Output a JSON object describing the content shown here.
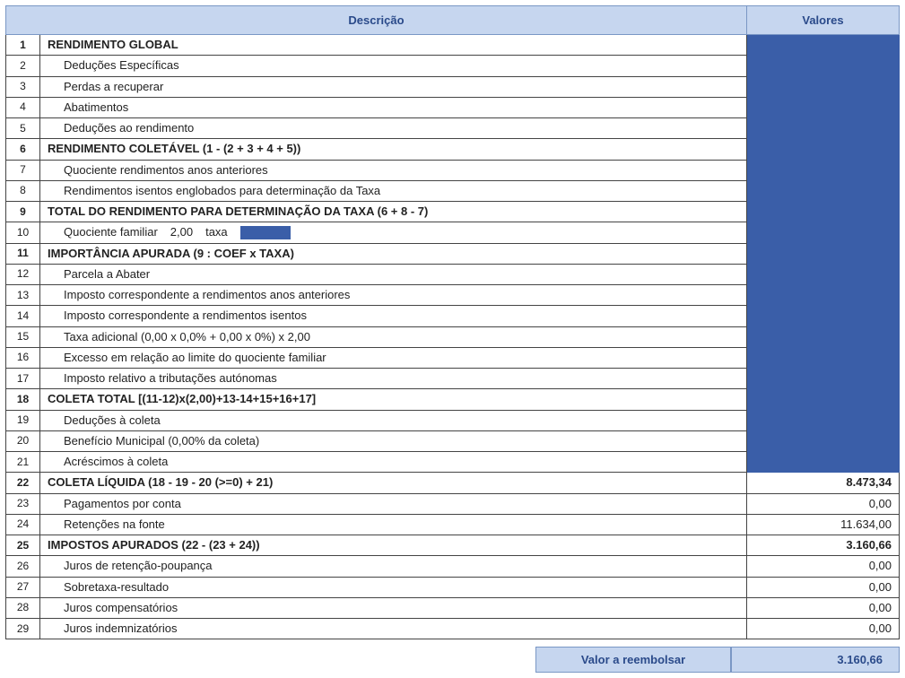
{
  "headers": {
    "descricao": "Descrição",
    "valores": "Valores"
  },
  "rows": [
    {
      "n": "1",
      "label": "RENDIMENTO GLOBAL",
      "bold": true,
      "indent": false,
      "value": "",
      "masked": true
    },
    {
      "n": "2",
      "label": "Deduções Específicas",
      "bold": false,
      "indent": true,
      "value": "",
      "masked": true
    },
    {
      "n": "3",
      "label": "Perdas a recuperar",
      "bold": false,
      "indent": true,
      "value": "",
      "masked": true
    },
    {
      "n": "4",
      "label": "Abatimentos",
      "bold": false,
      "indent": true,
      "value": "",
      "masked": true
    },
    {
      "n": "5",
      "label": "Deduções ao rendimento",
      "bold": false,
      "indent": true,
      "value": "",
      "masked": true
    },
    {
      "n": "6",
      "label": "RENDIMENTO COLETÁVEL (1 - (2 + 3 + 4 + 5))",
      "bold": true,
      "indent": false,
      "value": "",
      "masked": true
    },
    {
      "n": "7",
      "label": "Quociente rendimentos anos anteriores",
      "bold": false,
      "indent": true,
      "value": "",
      "masked": true
    },
    {
      "n": "8",
      "label": "Rendimentos isentos englobados para determinação da Taxa",
      "bold": false,
      "indent": true,
      "value": "",
      "masked": true
    },
    {
      "n": "9",
      "label": "TOTAL DO RENDIMENTO PARA DETERMINAÇÃO DA TAXA (6 + 8 - 7)",
      "bold": true,
      "indent": false,
      "value": "",
      "masked": true
    },
    {
      "n": "10",
      "label": "",
      "bold": false,
      "indent": true,
      "value": "",
      "masked": true,
      "special": "quociente"
    },
    {
      "n": "11",
      "label": "IMPORTÂNCIA APURADA (9 : COEF x TAXA)",
      "bold": true,
      "indent": false,
      "value": "",
      "masked": true
    },
    {
      "n": "12",
      "label": "Parcela a Abater",
      "bold": false,
      "indent": true,
      "value": "",
      "masked": true
    },
    {
      "n": "13",
      "label": "Imposto correspondente a rendimentos anos anteriores",
      "bold": false,
      "indent": true,
      "value": "",
      "masked": true
    },
    {
      "n": "14",
      "label": "Imposto correspondente a rendimentos isentos",
      "bold": false,
      "indent": true,
      "value": "",
      "masked": true
    },
    {
      "n": "15",
      "label": "Taxa adicional (0,00 x 0,0% + 0,00 x 0%) x 2,00",
      "bold": false,
      "indent": true,
      "value": "",
      "masked": true
    },
    {
      "n": "16",
      "label": "Excesso em relação ao limite do quociente familiar",
      "bold": false,
      "indent": true,
      "value": "",
      "masked": true
    },
    {
      "n": "17",
      "label": "Imposto relativo a tributações autónomas",
      "bold": false,
      "indent": true,
      "value": "",
      "masked": true
    },
    {
      "n": "18",
      "label": "COLETA TOTAL   [(11-12)x(2,00)+13-14+15+16+17]",
      "bold": true,
      "indent": false,
      "value": "",
      "masked": true
    },
    {
      "n": "19",
      "label": "Deduções à coleta",
      "bold": false,
      "indent": true,
      "value": "",
      "masked": true
    },
    {
      "n": "20",
      "label": "Benefício Municipal   (0,00% da coleta)",
      "bold": false,
      "indent": true,
      "value": "",
      "masked": true
    },
    {
      "n": "21",
      "label": "Acréscimos à coleta",
      "bold": false,
      "indent": true,
      "value": "",
      "masked": true
    },
    {
      "n": "22",
      "label": "COLETA LÍQUIDA (18 - 19 - 20 (>=0) + 21)",
      "bold": true,
      "indent": false,
      "value": "8.473,34",
      "masked": false
    },
    {
      "n": "23",
      "label": "Pagamentos por conta",
      "bold": false,
      "indent": true,
      "value": "0,00",
      "masked": false
    },
    {
      "n": "24",
      "label": "Retenções na fonte",
      "bold": false,
      "indent": true,
      "value": "11.634,00",
      "masked": false
    },
    {
      "n": "25",
      "label": "IMPOSTOS APURADOS (22 - (23 + 24))",
      "bold": true,
      "indent": false,
      "value": "3.160,66",
      "masked": false
    },
    {
      "n": "26",
      "label": "Juros de retenção-poupança",
      "bold": false,
      "indent": true,
      "value": "0,00",
      "masked": false
    },
    {
      "n": "27",
      "label": "Sobretaxa-resultado",
      "bold": false,
      "indent": true,
      "value": "0,00",
      "masked": false
    },
    {
      "n": "28",
      "label": "Juros compensatórios",
      "bold": false,
      "indent": true,
      "value": "0,00",
      "masked": false
    },
    {
      "n": "29",
      "label": "Juros indemnizatórios",
      "bold": false,
      "indent": true,
      "value": "0,00",
      "masked": false
    }
  ],
  "row10": {
    "quociente_label": "Quociente familiar",
    "quociente_value": "2,00",
    "taxa_label": "taxa"
  },
  "footer": {
    "label": "Valor a reembolsar",
    "value": "3.160,66"
  }
}
